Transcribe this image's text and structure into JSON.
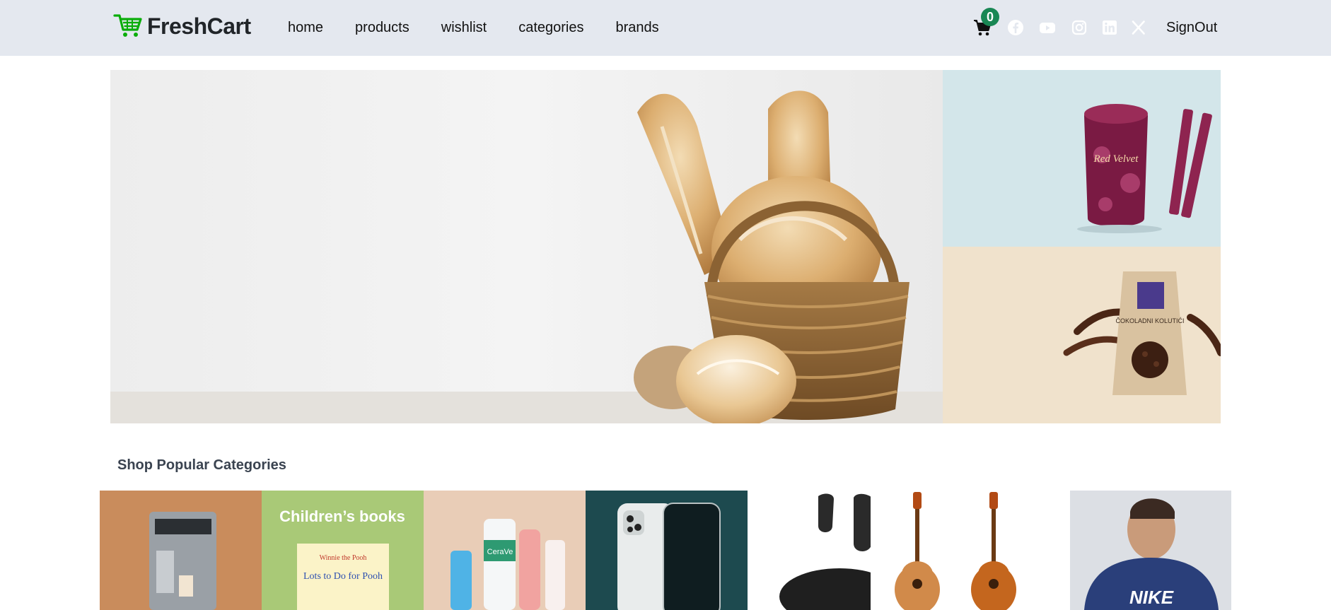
{
  "brand": {
    "name": "FreshCart",
    "color": "#0aad0a"
  },
  "nav": {
    "links": [
      "home",
      "products",
      "wishlist",
      "categories",
      "brands"
    ]
  },
  "cart": {
    "count": "0",
    "badge_color": "#198754"
  },
  "social": [
    "facebook-icon",
    "youtube-icon",
    "instagram-icon",
    "linkedin-icon",
    "x-icon"
  ],
  "signout_label": "SignOut",
  "hero": {
    "main": {
      "label": "bread-basket-banner"
    },
    "side_top": {
      "label": "red-velvet-wafer-rolls-banner",
      "product_text": "Red Velvet"
    },
    "side_bottom": {
      "label": "cookies-banner",
      "product_text": "ČOKOLADNI KOLUTIĆI"
    }
  },
  "categories": {
    "title": "Shop Popular Categories",
    "items": [
      {
        "name": "coffee-machine"
      },
      {
        "name": "childrens-books",
        "overlay": "Children’s books",
        "book_title": "Lots to Do for Pooh",
        "book_brand": "Winnie the Pooh"
      },
      {
        "name": "beauty-products",
        "brand_text": "CeraVe"
      },
      {
        "name": "mobile-phone"
      },
      {
        "name": "earbuds"
      },
      {
        "name": "guitar"
      },
      {
        "name": "mens-fashion",
        "brand_text": "NIKE"
      }
    ]
  }
}
